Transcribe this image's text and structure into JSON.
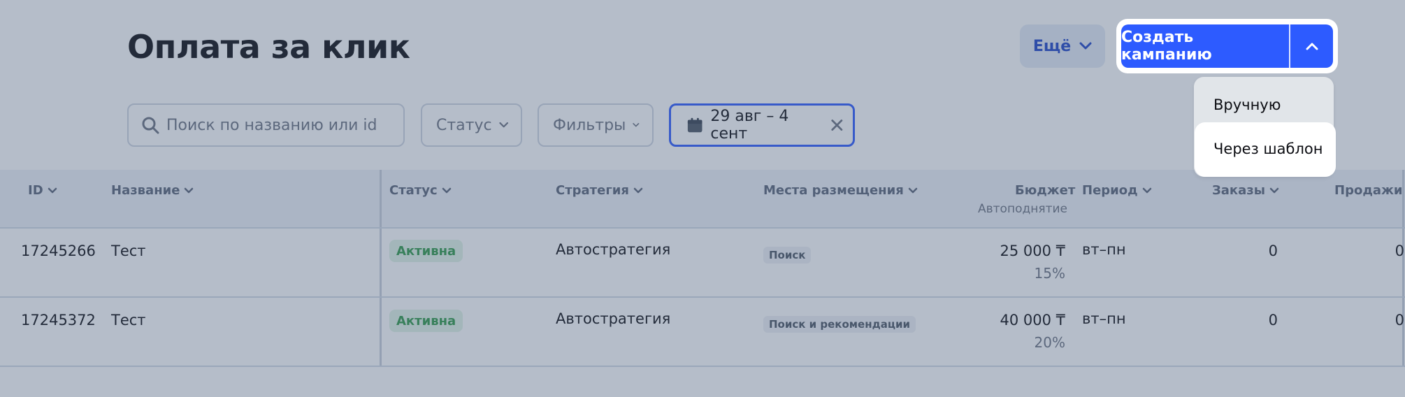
{
  "header": {
    "title": "Оплата за клик"
  },
  "toolbar": {
    "more_label": "Ещё",
    "create_label": "Создать кампанию",
    "create_menu": [
      "Вручную",
      "Через шаблон"
    ]
  },
  "filters": {
    "search_placeholder": "Поиск по названию или id",
    "status_label": "Статус",
    "filters_label": "Фильтры",
    "date_range": "29 авг – 4 сент"
  },
  "table": {
    "columns": {
      "id": "ID",
      "name": "Название",
      "status": "Статус",
      "strategy": "Стратегия",
      "placement": "Места размещения",
      "budget": "Бюджет",
      "budget_sub": "Автоподнятие",
      "period": "Период",
      "orders": "Заказы",
      "sales": "Продажи"
    },
    "rows": [
      {
        "id": "17245266",
        "name": "Тест",
        "status": "Активна",
        "strategy": "Автостратегия",
        "placement": "Поиск",
        "budget": "25 000 ₸",
        "autoraise": "15%",
        "period": "вт–пн",
        "orders": "0",
        "sales": "0"
      },
      {
        "id": "17245372",
        "name": "Тест",
        "status": "Активна",
        "strategy": "Автостратегия",
        "placement": "Поиск и рекомендации",
        "budget": "40 000 ₸",
        "autoraise": "20%",
        "period": "вт–пн",
        "orders": "0",
        "sales": "0"
      }
    ]
  },
  "colors": {
    "accent": "#2d5bff",
    "active": "#2f9a48",
    "overlay": "rgba(70,90,120,0.40)"
  }
}
